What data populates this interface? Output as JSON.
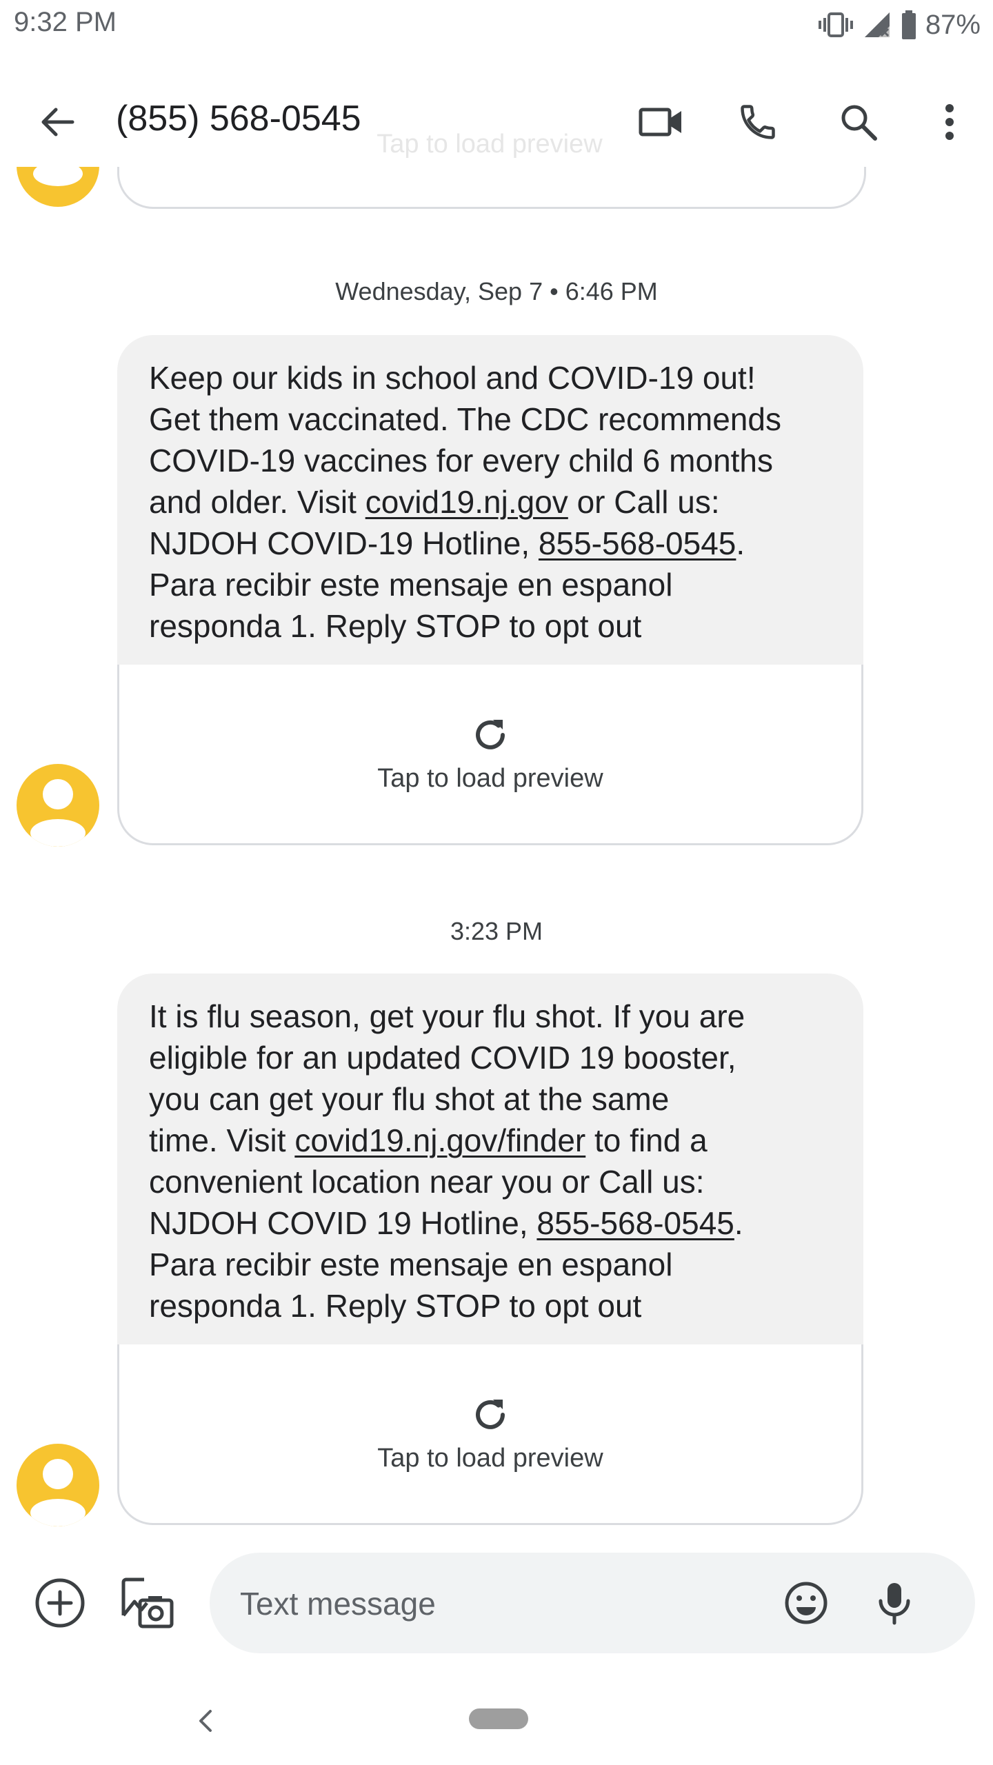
{
  "status_bar": {
    "time": "9:32 PM",
    "battery": "87%",
    "icons": [
      "vibrate-icon",
      "no-signal-icon",
      "battery-icon"
    ]
  },
  "app_bar": {
    "title": "(855) 568-0545",
    "icons": [
      "back-arrow-icon",
      "video-call-icon",
      "phone-icon",
      "search-icon",
      "more-vert-icon"
    ]
  },
  "ghost_preview": {
    "label": "Tap to load preview"
  },
  "conversation": [
    {
      "timestamp": "Wednesday, Sep 7 • 6:46 PM",
      "lines": [
        [
          {
            "t": "Keep our kids in school and COVID-19 out!"
          }
        ],
        [
          {
            "t": "Get them vaccinated. The CDC recommends"
          }
        ],
        [
          {
            "t": "COVID-19 vaccines for every child 6 months"
          }
        ],
        [
          {
            "t": "and older. Visit "
          },
          {
            "t": "covid19.nj.gov",
            "link": true
          },
          {
            "t": " or Call us:"
          }
        ],
        [
          {
            "t": "NJDOH COVID-19 Hotline, "
          },
          {
            "t": "855-568-0545",
            "link": true
          },
          {
            "t": "."
          }
        ],
        [
          {
            "t": "Para recibir este mensaje en espanol"
          }
        ],
        [
          {
            "t": "responda 1. Reply STOP to opt out"
          }
        ]
      ],
      "preview_label": "Tap to load preview"
    },
    {
      "timestamp": "3:23 PM",
      "lines": [
        [
          {
            "t": "It is flu season, get your flu shot. If you are"
          }
        ],
        [
          {
            "t": "eligible for an updated COVID 19 booster,"
          }
        ],
        [
          {
            "t": "you can get your flu shot at the same"
          }
        ],
        [
          {
            "t": "time. Visit "
          },
          {
            "t": "covid19.nj.gov/finder",
            "link": true
          },
          {
            "t": " to find a"
          }
        ],
        [
          {
            "t": "convenient location near you or Call us:"
          }
        ],
        [
          {
            "t": "NJDOH COVID 19 Hotline, "
          },
          {
            "t": "855-568-0545",
            "link": true
          },
          {
            "t": "."
          }
        ],
        [
          {
            "t": "Para recibir este mensaje en espanol"
          }
        ],
        [
          {
            "t": "responda 1. Reply STOP to opt out"
          }
        ]
      ],
      "preview_label": "Tap to load preview"
    }
  ],
  "compose": {
    "placeholder": "Text message",
    "icons": [
      "add-circle-icon",
      "gallery-camera-icon",
      "emoji-icon",
      "mic-icon"
    ]
  },
  "colors": {
    "avatar": "#f7c430",
    "bubble": "#f1f1f1",
    "compose_bg": "#f1f3f4"
  }
}
